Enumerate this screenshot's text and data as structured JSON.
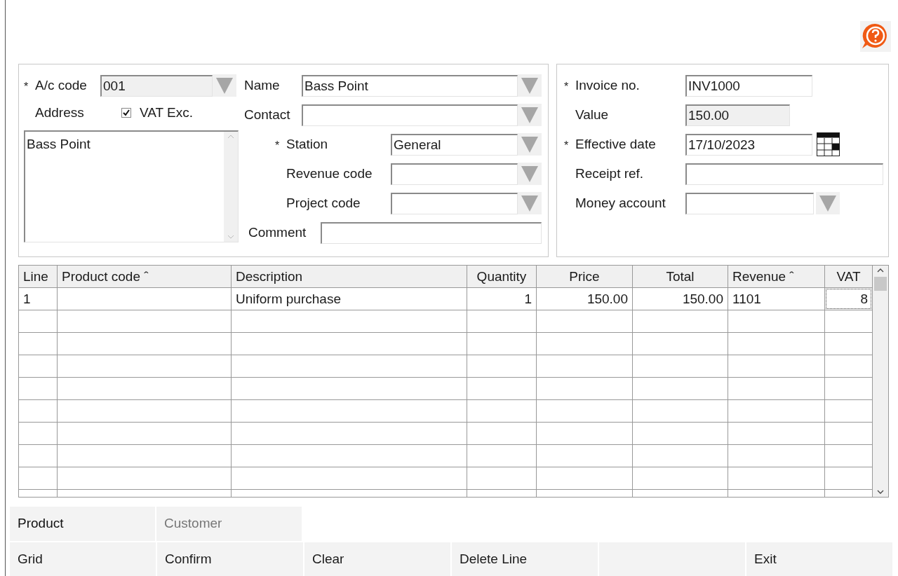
{
  "account_code": {
    "asterisk": "*",
    "label": "A/c code",
    "value": "001",
    "readonly": true
  },
  "address": {
    "label": "Address",
    "value": "Bass Point"
  },
  "vat_exempt": {
    "label": "VAT Exc.",
    "checked": true
  },
  "customer_fields": [
    {
      "label": "Name",
      "value": "Bass Point"
    },
    {
      "label": "Contact"
    }
  ],
  "analysis_fields": [
    {
      "asterisk": "*",
      "label": "Station",
      "value": "General"
    },
    {
      "label": "Revenue code"
    },
    {
      "label": "Project code"
    }
  ],
  "comment": {
    "label": "Comment"
  },
  "invoice_fields": [
    {
      "asterisk": "*",
      "label": "Invoice no.",
      "value": "INV1000",
      "kind": "text"
    },
    {
      "label": "Value",
      "value": "150.00",
      "kind": "readonly"
    },
    {
      "asterisk": "*",
      "label": "Effective date",
      "value": "17/10/2023",
      "kind": "date"
    },
    {
      "label": "Receipt ref.",
      "kind": "wide"
    },
    {
      "label": "Money account",
      "kind": "dropdown"
    }
  ],
  "table": {
    "columns": [
      {
        "label": "Line",
        "kind": "text"
      },
      {
        "label": "Product code ˆ",
        "kind": "text"
      },
      {
        "label": "Description",
        "kind": "text"
      },
      {
        "label": "Quantity",
        "kind": "number"
      },
      {
        "label": "Price",
        "kind": "number"
      },
      {
        "label": "Total",
        "kind": "number"
      },
      {
        "label": "Revenue ˆ",
        "kind": "text"
      },
      {
        "label": "VAT",
        "kind": "number"
      }
    ],
    "rows": [
      {
        "cells": [
          {
            "text": "1",
            "focused": false
          },
          {
            "focused": false
          },
          {
            "text": "Uniform purchase",
            "focused": false
          },
          {
            "text": "1",
            "focused": false
          },
          {
            "text": "150.00",
            "focused": false
          },
          {
            "text": "150.00",
            "focused": false
          },
          {
            "text": "1101",
            "focused": false
          },
          {
            "text": "8",
            "focused": true
          }
        ]
      }
    ]
  },
  "tabs": [
    {
      "label": "Product",
      "disabled": false
    },
    {
      "label": "Customer",
      "disabled": true
    }
  ],
  "actions": [
    {
      "kind": "button",
      "label": "Grid"
    },
    {
      "kind": "button",
      "label": "Confirm"
    },
    {
      "kind": "button",
      "label": "Clear"
    },
    {
      "kind": "button",
      "label": "Delete Line"
    },
    {
      "kind": "blank"
    },
    {
      "kind": "button",
      "label": "Exit"
    }
  ]
}
